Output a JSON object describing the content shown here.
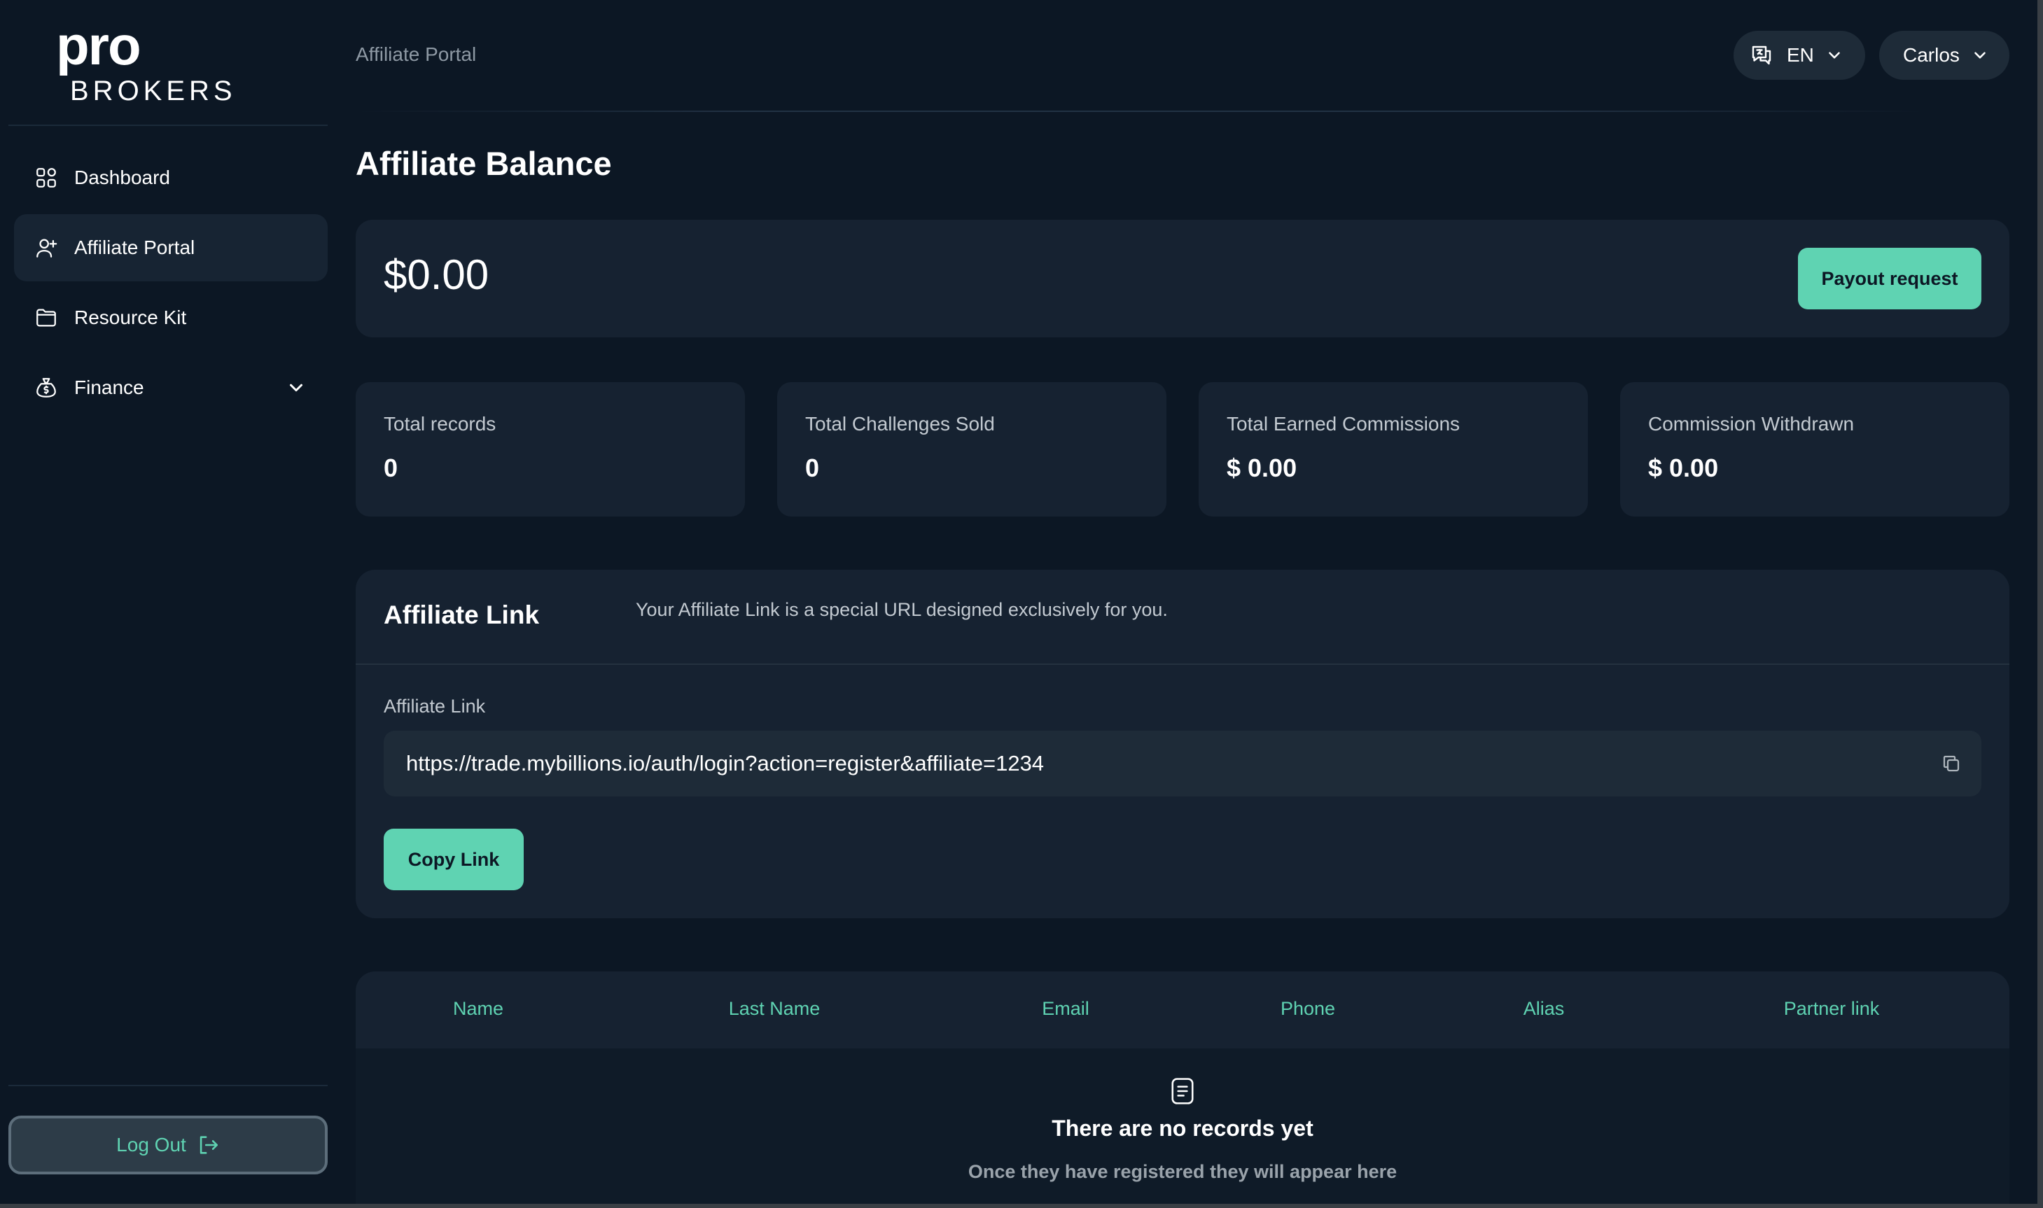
{
  "brand": {
    "logo_top": "pro",
    "logo_bottom": "BROKERS"
  },
  "sidebar": {
    "items": [
      {
        "label": "Dashboard",
        "icon": "dashboard-grid-icon"
      },
      {
        "label": "Affiliate Portal",
        "icon": "user-plus-icon",
        "active": true
      },
      {
        "label": "Resource Kit",
        "icon": "folder-icon"
      },
      {
        "label": "Finance",
        "icon": "money-bag-icon",
        "has_dropdown": true
      }
    ],
    "logout_label": "Log Out"
  },
  "header": {
    "breadcrumb": "Affiliate Portal",
    "language": "EN",
    "user_name": "Carlos"
  },
  "main": {
    "title": "Affiliate Balance",
    "balance": "$0.00",
    "payout_label": "Payout request",
    "stats": [
      {
        "label": "Total records",
        "value": "0"
      },
      {
        "label": "Total Challenges Sold",
        "value": "0"
      },
      {
        "label": "Total Earned Commissions",
        "value": "$ 0.00"
      },
      {
        "label": "Commission Withdrawn",
        "value": "$ 0.00"
      }
    ],
    "affiliate_link": {
      "title": "Affiliate Link",
      "description": "Your Affiliate Link is a special URL designed exclusively for you.",
      "field_label": "Affiliate Link",
      "url": "https://trade.mybillions.io/auth/login?action=register&affiliate=1234",
      "copy_label": "Copy Link"
    },
    "table": {
      "columns": [
        "Name",
        "Last Name",
        "Email",
        "Phone",
        "Alias",
        "Partner link"
      ],
      "empty_title": "There are no records yet",
      "empty_subtitle": "Once they have registered they will appear here"
    }
  },
  "colors": {
    "background": "#0c1724",
    "card": "#162231",
    "accent": "#5fd3b2",
    "muted_text": "#c3cad1"
  }
}
